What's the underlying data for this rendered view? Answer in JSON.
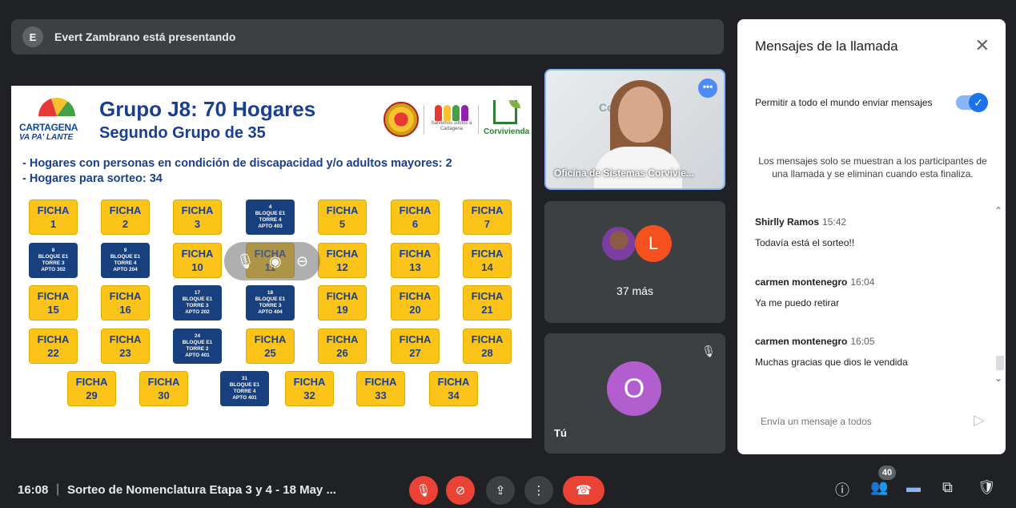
{
  "presenter": {
    "avatar": "E",
    "text": "Evert Zambrano está presentando"
  },
  "slide": {
    "logo_line1": "CARTAGENA",
    "logo_line2": "VA PA' LANTE",
    "title": "Grupo J8: 70 Hogares",
    "subtitle": "Segundo Grupo de 35",
    "salvemos": "Salvemos Juntos a Cartagena",
    "corvivienda": "Corvivienda",
    "bullet1": "-  Hogares con personas en condición de discapacidad y/o adultos mayores: 2",
    "bullet2": "-  Hogares para sorteo: 34",
    "tiles": [
      {
        "kind": "y",
        "l1": "FICHA",
        "l2": "1"
      },
      {
        "kind": "y",
        "l1": "FICHA",
        "l2": "2"
      },
      {
        "kind": "y",
        "l1": "FICHA",
        "l2": "3"
      },
      {
        "kind": "b",
        "l1": "4",
        "l2": "BLOQUE E1",
        "l3": "TORRE 4",
        "l4": "APTO 403"
      },
      {
        "kind": "y",
        "l1": "FICHA",
        "l2": "5"
      },
      {
        "kind": "y",
        "l1": "FICHA",
        "l2": "6"
      },
      {
        "kind": "y",
        "l1": "FICHA",
        "l2": "7"
      },
      {
        "kind": "b",
        "l1": "8",
        "l2": "BLOQUE E1",
        "l3": "TORRE 3",
        "l4": "APTO 302"
      },
      {
        "kind": "b",
        "l1": "9",
        "l2": "BLOQUE E1",
        "l3": "TORRE 4",
        "l4": "APTO 204"
      },
      {
        "kind": "y",
        "l1": "FICHA",
        "l2": "10"
      },
      {
        "kind": "y",
        "l1": "FICHA",
        "l2": "11"
      },
      {
        "kind": "y",
        "l1": "FICHA",
        "l2": "12"
      },
      {
        "kind": "y",
        "l1": "FICHA",
        "l2": "13"
      },
      {
        "kind": "y",
        "l1": "FICHA",
        "l2": "14"
      },
      {
        "kind": "y",
        "l1": "FICHA",
        "l2": "15"
      },
      {
        "kind": "y",
        "l1": "FICHA",
        "l2": "16"
      },
      {
        "kind": "b",
        "l1": "17",
        "l2": "BLOQUE E1",
        "l3": "TORRE 3",
        "l4": "APTO 202"
      },
      {
        "kind": "b",
        "l1": "18",
        "l2": "BLOQUE E1",
        "l3": "TORRE 3",
        "l4": "APTO 404"
      },
      {
        "kind": "y",
        "l1": "FICHA",
        "l2": "19"
      },
      {
        "kind": "y",
        "l1": "FICHA",
        "l2": "20"
      },
      {
        "kind": "y",
        "l1": "FICHA",
        "l2": "21"
      },
      {
        "kind": "y",
        "l1": "FICHA",
        "l2": "22"
      },
      {
        "kind": "y",
        "l1": "FICHA",
        "l2": "23"
      },
      {
        "kind": "b",
        "l1": "24",
        "l2": "BLOQUE E1",
        "l3": "TORRE 2",
        "l4": "APTO 401"
      },
      {
        "kind": "y",
        "l1": "FICHA",
        "l2": "25"
      },
      {
        "kind": "y",
        "l1": "FICHA",
        "l2": "26"
      },
      {
        "kind": "y",
        "l1": "FICHA",
        "l2": "27"
      },
      {
        "kind": "y",
        "l1": "FICHA",
        "l2": "28"
      },
      {
        "kind": "y",
        "l1": "FICHA",
        "l2": "29"
      },
      {
        "kind": "y",
        "l1": "FICHA",
        "l2": "30"
      },
      {
        "kind": "b",
        "l1": "31",
        "l2": "BLOQUE E1",
        "l3": "TORRE 4",
        "l4": "APTO 401"
      },
      {
        "kind": "y",
        "l1": "FICHA",
        "l2": "32"
      },
      {
        "kind": "y",
        "l1": "FICHA",
        "l2": "33"
      },
      {
        "kind": "y",
        "l1": "FICHA",
        "l2": "34"
      }
    ]
  },
  "tiles": {
    "speaker_name": "Oficina de Sistemas Corvivie...",
    "wall_text": "Cor",
    "more_avatar_letter": "L",
    "more_count": "37 más",
    "self_letter": "O",
    "self_label": "Tú"
  },
  "chat": {
    "title": "Mensajes de la llamada",
    "allow_label": "Permitir a todo el mundo enviar mensajes",
    "notice": "Los mensajes solo se muestran a los participantes de una llamada y se eliminan cuando esta finaliza.",
    "messages": [
      {
        "sender": "Shirlly Ramos",
        "time": "15:42",
        "body": "Todavía está el sorteo!!"
      },
      {
        "sender": "carmen montenegro",
        "time": "16:04",
        "body": "Ya me puedo retirar"
      },
      {
        "sender": "carmen montenegro",
        "time": "16:05",
        "body": "Muchas gracias que dios le vendida"
      }
    ],
    "placeholder": "Envía un mensaje a todos"
  },
  "bottom": {
    "time": "16:08",
    "divider": "|",
    "meeting_title": "Sorteo de Nomenclatura Etapa 3 y 4 - 18 May ...",
    "participants_badge": "40"
  },
  "colors": {
    "accent": "#1a73e8",
    "danger": "#ea4335",
    "tile_yellow": "#fcc419",
    "tile_blue": "#183f7e"
  }
}
